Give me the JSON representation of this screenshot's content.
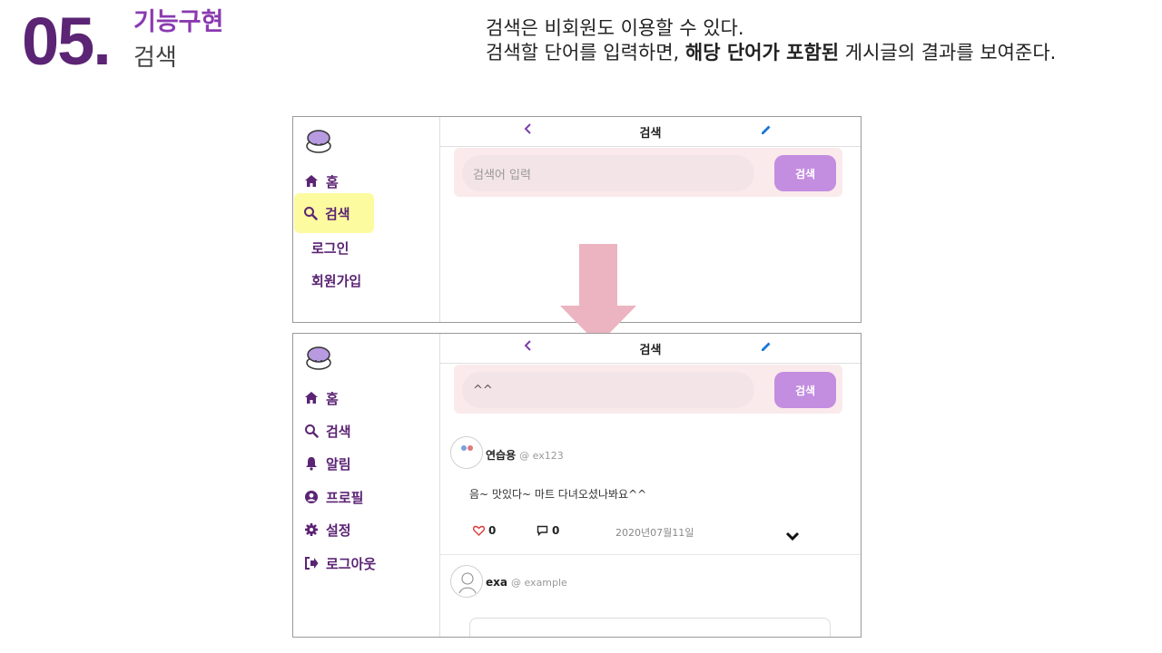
{
  "slide": {
    "number": "05.",
    "title": "기능구현",
    "subtitle": "검색",
    "desc_line1": "검색은 비회원도 이용할 수 있다.",
    "desc_line2_pre": "검색할 단어를 입력하면, ",
    "desc_line2_bold": "해당 단어가 포함된",
    "desc_line2_post": " 게시글의 결과를 보여준다."
  },
  "colors": {
    "brand": "#5b2474",
    "accent": "#c38de0",
    "highlight": "#fdfb9f",
    "arrow": "#ebb4c0"
  },
  "before": {
    "page_title": "검색",
    "nav": [
      {
        "label": "홈",
        "icon": "home-icon"
      },
      {
        "label": "검색",
        "icon": "search-icon",
        "active": true
      },
      {
        "label": "로그인"
      },
      {
        "label": "회원가입"
      }
    ],
    "search_placeholder": "검색어 입력",
    "search_button": "검색"
  },
  "after": {
    "page_title": "검색",
    "nav": [
      {
        "label": "홈",
        "icon": "home-icon"
      },
      {
        "label": "검색",
        "icon": "search-icon"
      },
      {
        "label": "알림",
        "icon": "bell-icon"
      },
      {
        "label": "프로필",
        "icon": "user-circle-icon"
      },
      {
        "label": "설정",
        "icon": "gear-icon"
      },
      {
        "label": "로그아웃",
        "icon": "sign-out-icon"
      }
    ],
    "search_value": "^^",
    "search_button": "검색",
    "posts": [
      {
        "name": "연습용",
        "handle": "@ ex123",
        "content": "음~ 맛있다~ 마트 다녀오셨나봐요^^",
        "likes": "0",
        "comments": "0",
        "date": "2020년07월11일"
      },
      {
        "name": "exa",
        "handle": "@ example"
      }
    ]
  }
}
